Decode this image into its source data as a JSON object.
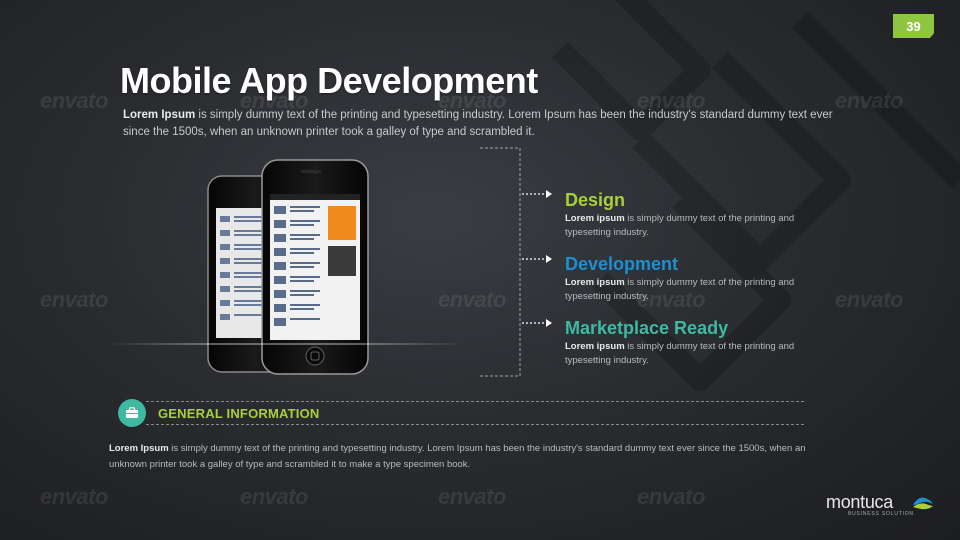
{
  "page_number": "39",
  "title": "Mobile App Development",
  "intro": {
    "lead": "Lorem Ipsum",
    "text": " is simply dummy text of the printing and typesetting industry. Lorem Ipsum has been the industry's standard dummy text ever since the 1500s, when an unknown  printer took a galley of type and scrambled it."
  },
  "features": [
    {
      "title": "Design",
      "color": "#a8cf3c",
      "lead": "Lorem ipsum",
      "text": "  is simply dummy text of the printing and typesetting industry."
    },
    {
      "title": "Development",
      "color": "#1e8fd0",
      "lead": "Lorem ipsum",
      "text": "  is simply dummy text of the printing and typesetting industry."
    },
    {
      "title": "Marketplace Ready",
      "color": "#3fb9a2",
      "lead": "Lorem ipsum",
      "text": "  is simply dummy text of the printing and typesetting industry."
    }
  ],
  "general": {
    "icon": "briefcase-icon",
    "title": "GENERAL INFORMATION",
    "lead": "Lorem Ipsum",
    "text": " is simply dummy text of the printing and typesetting industry. Lorem Ipsum has been the industry's standard dummy text ever since the 1500s, when an unknown printer took a galley of type and scrambled it to make a type specimen book."
  },
  "watermark_text": "envato",
  "logo": {
    "name": "montuca",
    "tagline": "BUSINESS SOLUTION"
  },
  "colors": {
    "accent_green": "#8fc63f",
    "teal": "#3fb9a2",
    "blue": "#1e8fd0"
  }
}
